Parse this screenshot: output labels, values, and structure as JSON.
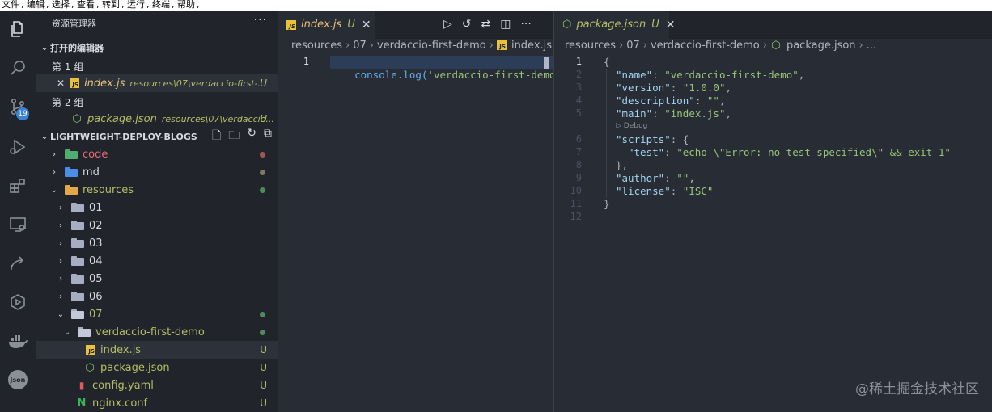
{
  "menubar": {
    "items": [
      "文件",
      "编辑",
      "选择",
      "查看",
      "转到",
      "运行",
      "终端",
      "帮助"
    ]
  },
  "activity": {
    "scm_badge": "19",
    "icons": [
      "files-icon",
      "search-icon",
      "source-control-icon",
      "run-debug-icon",
      "extensions-icon",
      "remote-explorer-icon",
      "share-icon",
      "debug-panel-icon",
      "docker-icon",
      "json-icon"
    ]
  },
  "sidebar": {
    "title": "资源管理器",
    "more": "···",
    "open_editors": {
      "header": "打开的编辑器",
      "group1": "第 1 组",
      "group2": "第 2 组",
      "items": [
        {
          "name": "index.js",
          "path": "resources\\07\\verdaccio-first-...",
          "status": "U"
        },
        {
          "name": "package.json",
          "path": "resources\\07\\verdaccio...",
          "status": "U"
        }
      ]
    },
    "workspace": {
      "header": "LIGHTWEIGHT-DEPLOY-BLOGS",
      "tree": [
        {
          "label": "code",
          "status": ""
        },
        {
          "label": "md",
          "status": ""
        },
        {
          "label": "resources",
          "status": ""
        },
        {
          "label": "01",
          "status": ""
        },
        {
          "label": "02",
          "status": ""
        },
        {
          "label": "03",
          "status": ""
        },
        {
          "label": "04",
          "status": ""
        },
        {
          "label": "05",
          "status": ""
        },
        {
          "label": "06",
          "status": ""
        },
        {
          "label": "07",
          "status": ""
        },
        {
          "label": "verdaccio-first-demo",
          "status": ""
        },
        {
          "label": "index.js",
          "status": "U"
        },
        {
          "label": "package.json",
          "status": "U"
        },
        {
          "label": "config.yaml",
          "status": "U"
        },
        {
          "label": "nginx.conf",
          "status": "U"
        }
      ]
    }
  },
  "left_editor": {
    "tab": {
      "name": "index.js",
      "status": "U",
      "close": "✕"
    },
    "breadcrumb": [
      "resources",
      "07",
      "verdaccio-first-demo",
      "index.js"
    ],
    "line_numbers": [
      "1"
    ],
    "code": {
      "fn": "console.log(",
      "str": "'verdaccio-first-demo'",
      "end": ")"
    }
  },
  "right_editor": {
    "tab": {
      "name": "package.json",
      "status": "U",
      "close": "✕"
    },
    "breadcrumb": [
      "resources",
      "07",
      "verdaccio-first-demo",
      "package.json",
      "..."
    ],
    "line_numbers": [
      "1",
      "2",
      "3",
      "4",
      "5",
      "6",
      "7",
      "8",
      "9",
      "10",
      "11",
      "12"
    ],
    "codelens": "▷ Debug",
    "lines": [
      {
        "k": "",
        "v": "{"
      },
      {
        "k": "\"name\"",
        "v": "\"verdaccio-first-demo\"",
        "t": ","
      },
      {
        "k": "\"version\"",
        "v": "\"1.0.0\"",
        "t": ","
      },
      {
        "k": "\"description\"",
        "v": "\"\"",
        "t": ","
      },
      {
        "k": "\"main\"",
        "v": "\"index.js\"",
        "t": ","
      },
      {
        "k": "\"scripts\"",
        "v": "{",
        "t": ""
      },
      {
        "k": "\"test\"",
        "v": "\"echo \\\"Error: no test specified\\\" && exit 1\"",
        "t": ""
      },
      {
        "k": "",
        "v": "},",
        "t": ""
      },
      {
        "k": "\"author\"",
        "v": "\"\"",
        "t": ","
      },
      {
        "k": "\"license\"",
        "v": "\"ISC\"",
        "t": ""
      },
      {
        "k": "",
        "v": "}",
        "t": ""
      },
      {
        "k": "",
        "v": "",
        "t": ""
      }
    ]
  },
  "watermark": "@稀土掘金技术社区",
  "colors": {
    "accent": "#3b83d6",
    "untracked": "#b5bd68",
    "string": "#98c379",
    "key": "#a3d2f0"
  }
}
